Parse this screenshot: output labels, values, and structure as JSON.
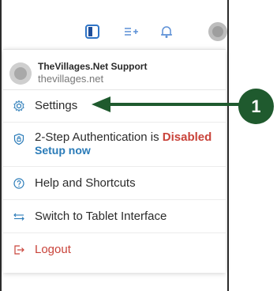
{
  "account": {
    "name": "TheVillages.Net Support",
    "domain": "thevillages.net"
  },
  "menu": {
    "settings": "Settings",
    "two_step_prefix": "2-Step Authentication is ",
    "two_step_status": "Disabled",
    "two_step_action": "Setup now",
    "help": "Help and Shortcuts",
    "switch": "Switch to Tablet Interface",
    "logout": "Logout"
  },
  "callout": {
    "number": "1"
  },
  "colors": {
    "callout_green": "#1f5a2e",
    "link_blue": "#2a7bb8",
    "danger_red": "#c9433a"
  },
  "icons": [
    "sidebar-toggle-icon",
    "sort-add-icon",
    "bell-icon",
    "avatar",
    "gear-icon",
    "shield-lock-icon",
    "help-circle-icon",
    "swap-arrows-icon",
    "logout-icon"
  ]
}
